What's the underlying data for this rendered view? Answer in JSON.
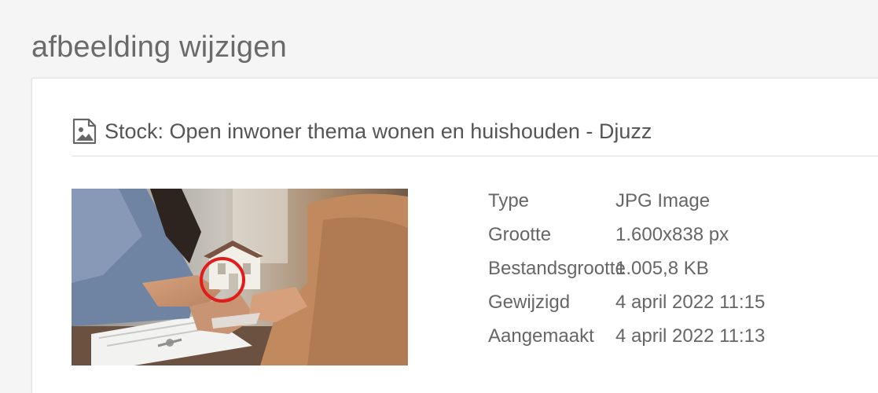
{
  "page": {
    "title": "afbeelding wijzigen"
  },
  "card": {
    "icon": "image-icon",
    "title": "Stock: Open inwoner thema wonen en huishouden - Djuzz"
  },
  "image": {
    "highlight_color": "#e21b1b"
  },
  "details": [
    {
      "label": "Type",
      "value": "JPG Image"
    },
    {
      "label": "Grootte",
      "value": "1.600x838 px"
    },
    {
      "label": "Bestandsgrootte",
      "value": "1.005,8 KB"
    },
    {
      "label": "Gewijzigd",
      "value": "4 april 2022 11:15"
    },
    {
      "label": "Aangemaakt",
      "value": "4 april 2022 11:13"
    }
  ]
}
